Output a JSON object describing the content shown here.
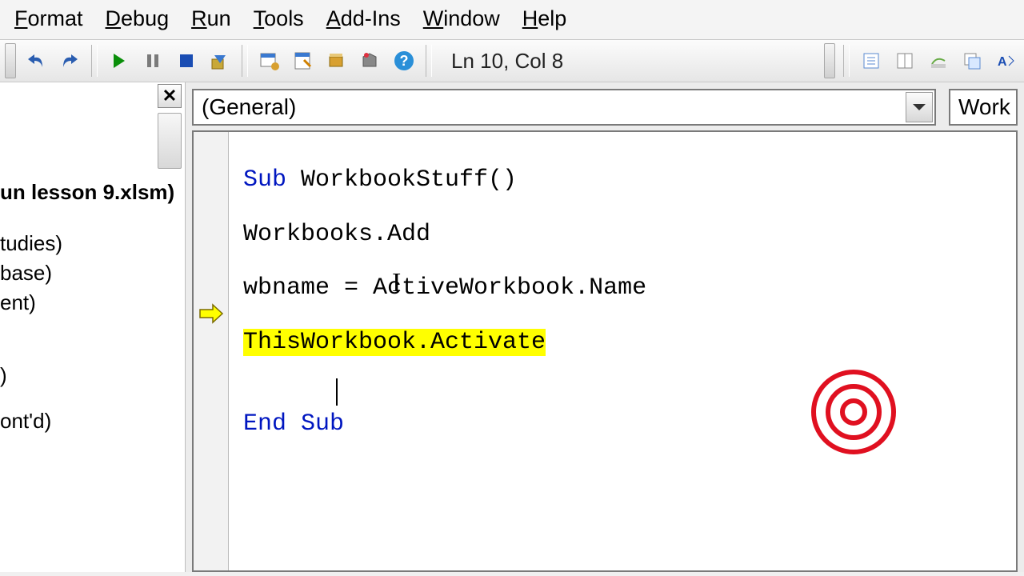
{
  "menu": {
    "format": "Format",
    "debug": "Debug",
    "run": "Run",
    "tools": "Tools",
    "addins": "Add-Ins",
    "window": "Window",
    "help": "Help"
  },
  "toolbar": {
    "position": "Ln 10, Col 8"
  },
  "sidebar": {
    "project_title": "un lesson 9.xlsm)",
    "items": [
      "tudies)",
      "base)",
      "ent)",
      ")",
      "ont'd)"
    ]
  },
  "editor": {
    "combo_object": "(General)",
    "combo_proc": "Work",
    "code": {
      "line1_kw": "Sub",
      "line1_rest": " WorkbookStuff()",
      "line3": "Workbooks.Add",
      "line5": "wbname = ActiveWorkbook.Name",
      "line7_hl": "ThisWorkbook.Activate",
      "line10_a": "End ",
      "line10_b": "Sub"
    }
  }
}
